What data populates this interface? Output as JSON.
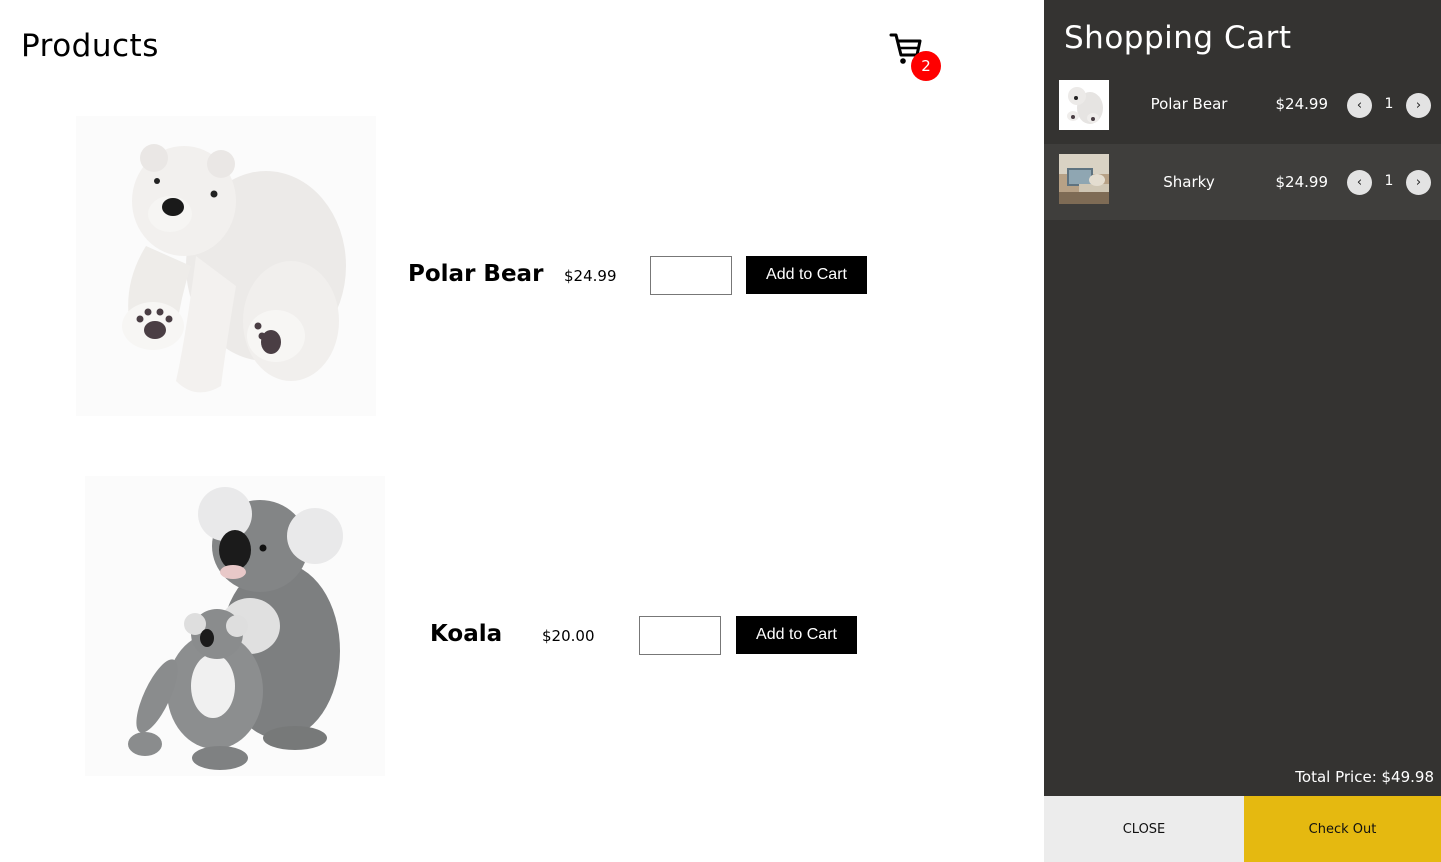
{
  "page": {
    "title": "Products"
  },
  "cart_button": {
    "count": "2",
    "icon": "cart-icon"
  },
  "products": [
    {
      "name": "Polar Bear",
      "price": "$24.99",
      "quantity_value": "",
      "button_label": "Add to Cart",
      "image": "polar-bear-plush"
    },
    {
      "name": "Koala",
      "price": "$20.00",
      "quantity_value": "",
      "button_label": "Add to Cart",
      "image": "koala-plush"
    }
  ],
  "cart": {
    "title": "Shopping Cart",
    "items": [
      {
        "name": "Polar Bear",
        "price": "$24.99",
        "quantity": "1",
        "image": "polar-bear-thumbnail"
      },
      {
        "name": "Sharky",
        "price": "$24.99",
        "quantity": "1",
        "image": "sharky-thumbnail"
      }
    ],
    "total": "Total Price: $49.98",
    "close_label": "CLOSE",
    "checkout_label": "Check Out"
  },
  "colors": {
    "panel_bg": "#343331",
    "alt_row_bg": "#3f3e3c",
    "checkout_bg": "#e5b910",
    "close_bg": "#ececec",
    "badge_bg": "#ff0000",
    "add_button_bg": "#000000"
  }
}
